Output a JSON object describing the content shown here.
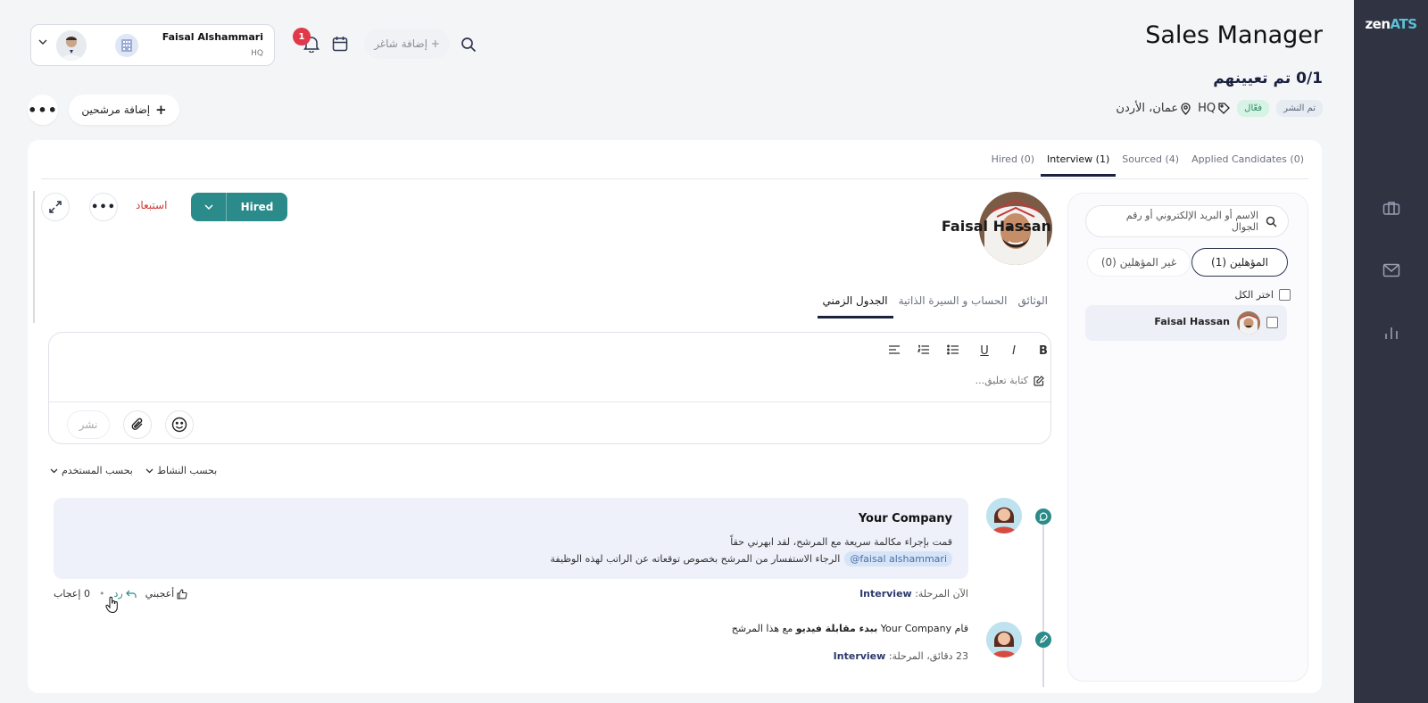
{
  "brand": {
    "logo_main": "zen",
    "logo_accent": "ATS"
  },
  "rail": {
    "items": [
      "briefcase-icon",
      "mail-icon",
      "chart-icon"
    ]
  },
  "header": {
    "job_title": "Sales Manager",
    "assigned": "0/1 تم تعيينهم",
    "location": "عمان، الأردن",
    "department": "HQ",
    "status_active": "فعّال",
    "status_published": "تم النشر",
    "add_candidates": "إضافة مرشحين",
    "add_talent": "+ إضافة شاغر",
    "notifications_count": "1",
    "user": {
      "name": "Faisal Alshammari",
      "org": "HQ"
    }
  },
  "pipeline_tabs": [
    {
      "label": "Applied Candidates (0)",
      "active": false
    },
    {
      "label": "Sourced (4)",
      "active": false
    },
    {
      "label": "Interview (1)",
      "active": true
    },
    {
      "label": "Hired (0)",
      "active": false
    }
  ],
  "candidate_list": {
    "search_placeholder": "الاسم أو البريد الإلكتروني أو رقم الجوال",
    "qualified": "المؤهلين (1)",
    "unqualified": "غير المؤهلين (0)",
    "select_all": "اختر الكل",
    "candidates": [
      {
        "name": "Faisal Hassan"
      }
    ]
  },
  "profile": {
    "name": "Faisal Hassan",
    "status_button": "Hired",
    "exclude": "استبعاد",
    "tabs": [
      {
        "label": "الجدول الزمني",
        "active": true
      },
      {
        "label": "الحساب و السيرة الذاتية",
        "active": false
      },
      {
        "label": "الوثائق",
        "active": false
      }
    ]
  },
  "editor": {
    "toolbar": [
      "B",
      "I",
      "U"
    ],
    "placeholder": "كتابة تعليق...",
    "post": "نشر"
  },
  "filters": {
    "by_activity": "بحسب النشاط",
    "by_user": "بحسب المستخدم"
  },
  "timeline": {
    "comment": {
      "author": "Your Company",
      "line1": "قمت بإجراء مكالمة سريعة مع المرشح، لقد ابهرني حقاً",
      "mention": "@faisal alshammari",
      "line2": "الرجاء الاستفسار من المرشح بخصوص توقعاته عن الراتب لهذه الوظيفة",
      "stage_prefix": "الآن المرحلة:",
      "stage": "Interview",
      "like": "أعجبني",
      "reply": "رد",
      "likes_count": "0 إعجاب"
    },
    "activity": {
      "prefix": "قام",
      "company": "Your Company",
      "action": "ببدء مقابلة فيديو",
      "suffix": "مع هذا المرشح",
      "time": "23 دقائق",
      "stage_prefix": "المرحلة:",
      "stage": "Interview"
    }
  },
  "colors": {
    "primary": "#2b8a8a",
    "navy": "#1b2240",
    "rail": "#2f3342",
    "danger": "#d23b3b"
  }
}
